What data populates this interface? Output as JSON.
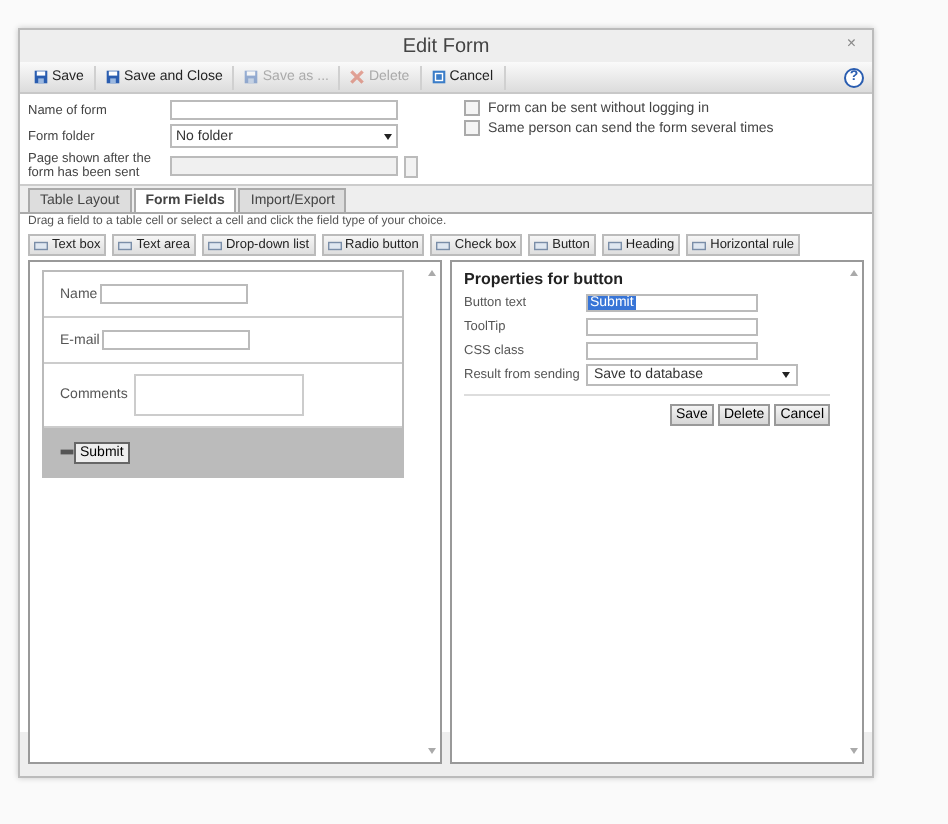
{
  "window": {
    "title": "Edit Form",
    "close": "×",
    "help": "?"
  },
  "toolbar": [
    {
      "label": "Save",
      "kind": "save",
      "disabled": false
    },
    {
      "label": "Save and Close",
      "kind": "save",
      "disabled": false
    },
    {
      "label": "Save as ...",
      "kind": "save",
      "disabled": true
    },
    {
      "label": "Delete",
      "kind": "delete",
      "disabled": true
    },
    {
      "label": "Cancel",
      "kind": "cancel",
      "disabled": false
    }
  ],
  "settings": {
    "name": {
      "label": "Name of form"
    },
    "folder": {
      "label": "Form folder",
      "value": "No folder"
    },
    "page": {
      "label": "Page shown after the form has been sent"
    },
    "options": [
      {
        "label": "Form can be sent without logging in",
        "checked": false
      },
      {
        "label": "Same person can send the form several times",
        "checked": false
      }
    ]
  },
  "tabs": [
    {
      "label": "Table Layout",
      "selected": false
    },
    {
      "label": "Form Fields",
      "selected": true
    },
    {
      "label": "Import/Export",
      "selected": false
    }
  ],
  "hint": "Drag a field to a table cell or select a cell and click the field type of your choice.",
  "field_types": [
    "Text box",
    "Text area",
    "Drop-down list",
    "Radio button",
    "Check box",
    "Button",
    "Heading",
    "Horizontal rule"
  ],
  "preview": {
    "rows": [
      {
        "kind": "input",
        "label": "Name"
      },
      {
        "kind": "input",
        "label": "E-mail"
      },
      {
        "kind": "textarea",
        "label": "Comments"
      },
      {
        "kind": "button",
        "label": "Submit",
        "selected": true
      }
    ]
  },
  "properties": {
    "title": "Properties for button",
    "fields": [
      {
        "kind": "input",
        "label": "Button text",
        "value": "Submit"
      },
      {
        "kind": "input",
        "label": "ToolTip"
      },
      {
        "kind": "input",
        "label": "CSS class"
      },
      {
        "kind": "select",
        "label": "Result from sending",
        "value": "Save to database"
      }
    ],
    "buttons": [
      "Save",
      "Delete",
      "Cancel"
    ]
  }
}
